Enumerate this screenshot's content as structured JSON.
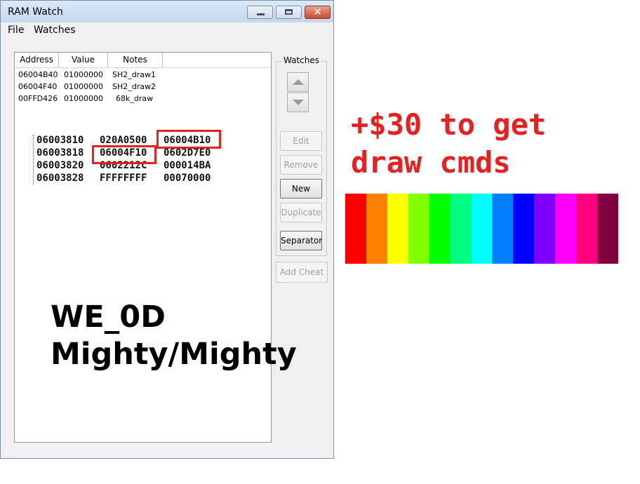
{
  "window": {
    "title": "RAM Watch",
    "menu": [
      "File",
      "Watches"
    ]
  },
  "list": {
    "columns": [
      "Address",
      "Value",
      "Notes"
    ],
    "rows": [
      {
        "address": "06004B40",
        "value": "01000000",
        "notes": "SH2_draw1"
      },
      {
        "address": "06004F40",
        "value": "01000000",
        "notes": "SH2_draw2"
      },
      {
        "address": "00FFD426",
        "value": "01000000",
        "notes": "68k_draw"
      }
    ]
  },
  "dump": [
    [
      "06003810",
      "020A0500",
      "06004B10"
    ],
    [
      "06003818",
      "06004F10",
      "0602D7E0"
    ],
    [
      "06003820",
      "0602212C",
      "000014BA"
    ],
    [
      "06003828",
      "FFFFFFFF",
      "00070000"
    ]
  ],
  "overlay": {
    "line1": "WE_0D",
    "line2": "Mighty/Mighty"
  },
  "watches": {
    "group_label": "Watches",
    "buttons": {
      "edit": "Edit",
      "remove": "Remove",
      "new": "New",
      "duplicate": "Duplicate",
      "separator": "Separator",
      "add_cheat": "Add Cheat"
    }
  },
  "annotation": {
    "line1": "+$30 to get",
    "line2": "draw cmds"
  },
  "palette": [
    "#ff0000",
    "#ff7f00",
    "#ffff00",
    "#80ff00",
    "#00ff00",
    "#00ff80",
    "#00ffff",
    "#0080ff",
    "#0000ff",
    "#8000ff",
    "#ff00ff",
    "#ff0080",
    "#800040"
  ],
  "highlight_color": "#e8201f"
}
